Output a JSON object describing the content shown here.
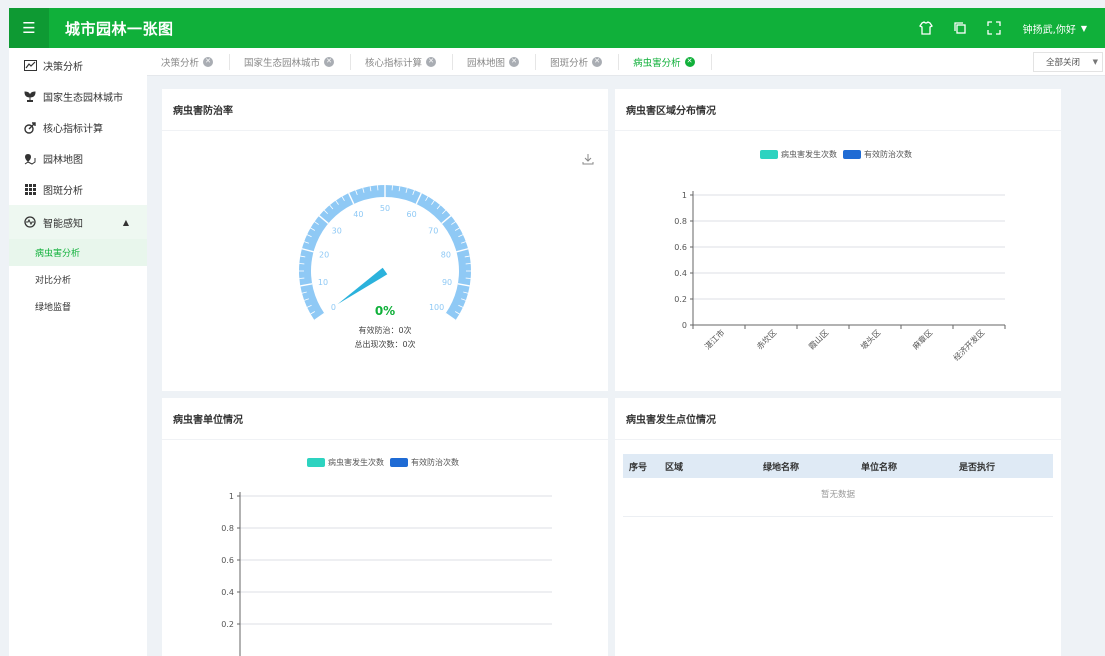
{
  "header": {
    "title": "城市园林一张图",
    "user": "钟扬武,你好"
  },
  "sidebar": {
    "items": [
      {
        "label": "决策分析",
        "icon": "chart-line-icon"
      },
      {
        "label": "国家生态园林城市",
        "icon": "plant-icon"
      },
      {
        "label": "核心指标计算",
        "icon": "target-icon"
      },
      {
        "label": "园林地图",
        "icon": "map-pin-icon"
      },
      {
        "label": "图斑分析",
        "icon": "grid-icon"
      }
    ],
    "group": {
      "label": "智能感知",
      "icon": "monitor-icon"
    },
    "sub_items": [
      "病虫害分析",
      "对比分析",
      "绿地监督"
    ]
  },
  "tabs": [
    "决策分析",
    "国家生态园林城市",
    "核心指标计算",
    "园林地图",
    "图斑分析",
    "病虫害分析"
  ],
  "active_tab": "病虫害分析",
  "close_all": "全部关闭",
  "panels": {
    "rate": {
      "title": "病虫害防治率",
      "percent": "0%",
      "effective": "有效防治：0次",
      "total": "总出现次数：0次"
    },
    "region": {
      "title": "病虫害区域分布情况"
    },
    "unit": {
      "title": "病虫害单位情况"
    },
    "points": {
      "title": "病虫害发生点位情况",
      "columns": [
        "序号",
        "区域",
        "绿地名称",
        "单位名称",
        "是否执行"
      ],
      "empty": "暂无数据"
    }
  },
  "legend": [
    "病虫害发生次数",
    "有效防治次数"
  ],
  "colors": {
    "brand": "#10b03a",
    "series1": "#2dd3c0",
    "series2": "#1f6bd4",
    "gauge": "#8fc9f5"
  },
  "chart_data": [
    {
      "type": "gauge",
      "title": "病虫害防治率",
      "value": 0,
      "min": 0,
      "max": 100,
      "ticks": [
        0,
        10,
        20,
        30,
        40,
        50,
        60,
        70,
        80,
        90,
        100
      ]
    },
    {
      "type": "bar",
      "title": "病虫害区域分布情况",
      "categories": [
        "湛江市",
        "赤坎区",
        "霞山区",
        "坡头区",
        "麻章区",
        "经济开发区"
      ],
      "series": [
        {
          "name": "病虫害发生次数",
          "values": [
            0,
            0,
            0,
            0,
            0,
            0
          ]
        },
        {
          "name": "有效防治次数",
          "values": [
            0,
            0,
            0,
            0,
            0,
            0
          ]
        }
      ],
      "yticks": [
        "0",
        "0.2",
        "0.4",
        "0.6",
        "0.8",
        "1"
      ],
      "ylim": [
        0,
        1
      ]
    },
    {
      "type": "bar",
      "title": "病虫害单位情况",
      "categories": [],
      "series": [
        {
          "name": "病虫害发生次数",
          "values": []
        },
        {
          "name": "有效防治次数",
          "values": []
        }
      ],
      "yticks": [
        "0.2",
        "0.4",
        "0.6",
        "0.8",
        "1"
      ],
      "ylim": [
        0,
        1
      ]
    }
  ]
}
